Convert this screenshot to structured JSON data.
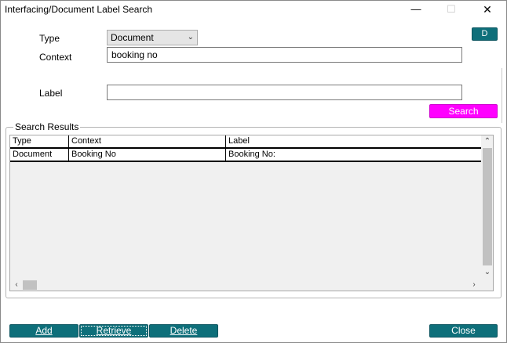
{
  "window": {
    "title": "Interfacing/Document Label Search",
    "minimize": "—",
    "maximize": "☐",
    "close": "✕"
  },
  "form": {
    "type_label": "Type",
    "type_value": "Document",
    "context_label": "Context",
    "context_value": "booking no",
    "label_label": "Label",
    "label_value": "",
    "d_button": "D",
    "search_button": "Search"
  },
  "results": {
    "group_title": "Search Results",
    "columns": [
      "Type",
      "Context",
      "Label"
    ],
    "rows": [
      {
        "type": "Document",
        "context": "Booking No",
        "label": "Booking No:"
      }
    ]
  },
  "footer": {
    "add": "Add",
    "retrieve": "Retrieve",
    "delete": "Delete",
    "close": "Close"
  },
  "colors": {
    "teal_button": "#0e6f7a",
    "search_button": "#ff00ff"
  }
}
